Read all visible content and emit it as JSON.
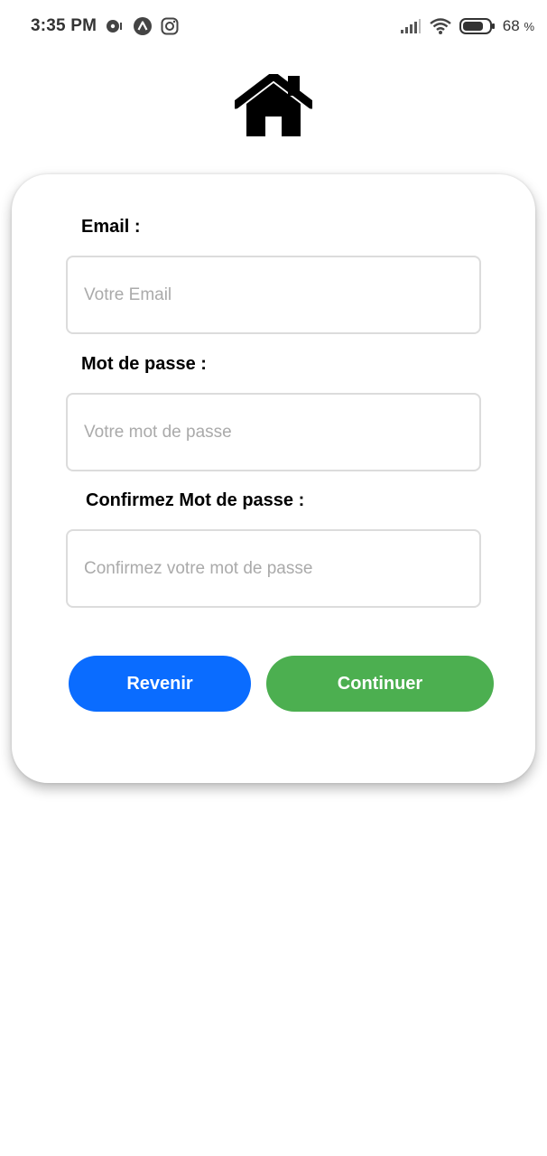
{
  "status_bar": {
    "time": "3:35 PM",
    "battery_percent": "68",
    "battery_unit": "%",
    "icons": [
      "media-icon",
      "assistant-icon",
      "instagram-icon",
      "signal-icon",
      "wifi-icon",
      "battery-icon"
    ]
  },
  "header": {
    "logo_icon": "home-icon"
  },
  "form": {
    "email": {
      "label": "Email :",
      "placeholder": "Votre Email"
    },
    "password": {
      "label": "Mot de passe :",
      "placeholder": "Votre mot de passe"
    },
    "confirm_password": {
      "label": "Confirmez Mot de passe :",
      "placeholder": "Confirmez votre mot de passe"
    }
  },
  "buttons": {
    "back_label": "Revenir",
    "continue_label": "Continuer"
  },
  "colors": {
    "back_button": "#0a6cff",
    "continue_button": "#4caf50"
  }
}
